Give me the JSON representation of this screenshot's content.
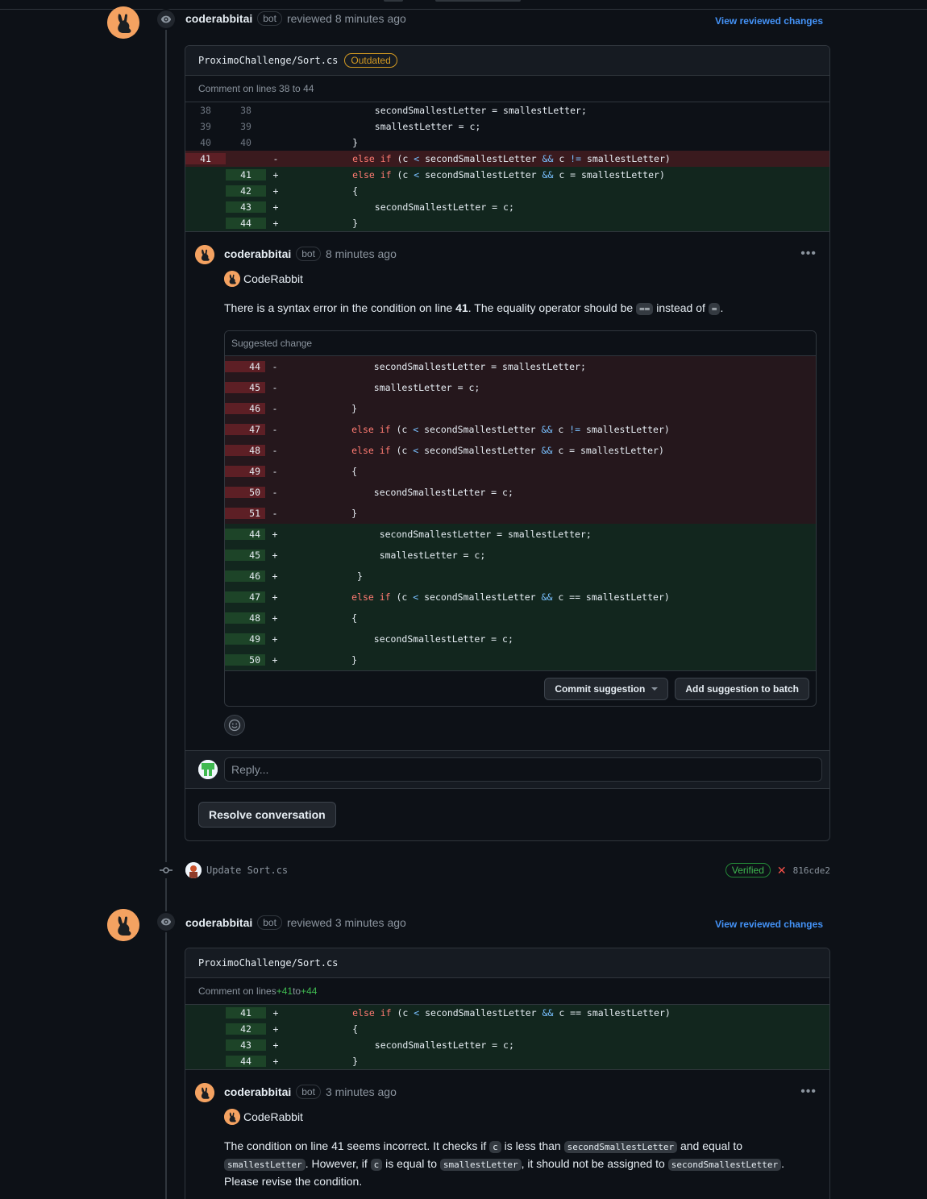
{
  "review1": {
    "author": "coderabbitai",
    "bot_label": "bot",
    "action": "reviewed 8 minutes ago",
    "view_link": "View reviewed changes",
    "file": "ProximoChallenge/Sort.cs",
    "outdated_label": "Outdated",
    "comment_lines": "Comment on lines 38 to 44",
    "diff": [
      {
        "old": "38",
        "new": "38",
        "sign": "",
        "type": "ctx",
        "code": "                secondSmallestLetter = smallestLetter;"
      },
      {
        "old": "39",
        "new": "39",
        "sign": "",
        "type": "ctx",
        "code": "                smallestLetter = c;"
      },
      {
        "old": "40",
        "new": "40",
        "sign": "",
        "type": "ctx",
        "code": "            }"
      },
      {
        "old": "41",
        "new": "",
        "sign": "-",
        "type": "del",
        "code": "            else if (c < secondSmallestLetter && c != smallestLetter)"
      },
      {
        "old": "",
        "new": "41",
        "sign": "+",
        "type": "add",
        "code": "            else if (c < secondSmallestLetter && c = smallestLetter)"
      },
      {
        "old": "",
        "new": "42",
        "sign": "+",
        "type": "add",
        "code": "            {"
      },
      {
        "old": "",
        "new": "43",
        "sign": "+",
        "type": "add",
        "code": "                secondSmallestLetter = c;"
      },
      {
        "old": "",
        "new": "44",
        "sign": "+",
        "type": "add",
        "code": "            }"
      }
    ],
    "comment": {
      "author": "coderabbitai",
      "bot_label": "bot",
      "time": "8 minutes ago",
      "brand": "CodeRabbit",
      "text_a": "There is a syntax error in the condition on line ",
      "text_line": "41",
      "text_b": ". The equality operator should be ",
      "chip1": "==",
      "text_c": " instead of ",
      "chip2": "=",
      "text_d": ".",
      "suggest_title": "Suggested change",
      "suggest_rows": [
        {
          "ln": "44",
          "sign": "-",
          "type": "del",
          "code": "                secondSmallestLetter = smallestLetter;"
        },
        {
          "ln": "45",
          "sign": "-",
          "type": "del",
          "code": "                smallestLetter = c;"
        },
        {
          "ln": "46",
          "sign": "-",
          "type": "del",
          "code": "            }"
        },
        {
          "ln": "47",
          "sign": "-",
          "type": "del",
          "code": "            else if (c < secondSmallestLetter && c != smallestLetter)"
        },
        {
          "ln": "48",
          "sign": "-",
          "type": "del",
          "code": "            else if (c < secondSmallestLetter && c = smallestLetter)"
        },
        {
          "ln": "49",
          "sign": "-",
          "type": "del",
          "code": "            {"
        },
        {
          "ln": "50",
          "sign": "-",
          "type": "del",
          "code": "                secondSmallestLetter = c;"
        },
        {
          "ln": "51",
          "sign": "-",
          "type": "del",
          "code": "            }"
        },
        {
          "ln": "44",
          "sign": "+",
          "type": "add",
          "code": "                 secondSmallestLetter = smallestLetter;"
        },
        {
          "ln": "45",
          "sign": "+",
          "type": "add",
          "code": "                 smallestLetter = c;"
        },
        {
          "ln": "46",
          "sign": "+",
          "type": "add",
          "code": "             }"
        },
        {
          "ln": "47",
          "sign": "+",
          "type": "add",
          "code": "            else if (c < secondSmallestLetter && c == smallestLetter)"
        },
        {
          "ln": "48",
          "sign": "+",
          "type": "add",
          "code": "            {"
        },
        {
          "ln": "49",
          "sign": "+",
          "type": "add",
          "code": "                secondSmallestLetter = c;"
        },
        {
          "ln": "50",
          "sign": "+",
          "type": "add",
          "code": "            }"
        }
      ],
      "commit_btn": "Commit suggestion",
      "batch_btn": "Add suggestion to batch"
    },
    "reply_placeholder": "Reply...",
    "resolve_btn": "Resolve conversation"
  },
  "commit": {
    "message": "Update Sort.cs",
    "verified": "Verified",
    "sha": "816cde2"
  },
  "review2": {
    "author": "coderabbitai",
    "bot_label": "bot",
    "action": "reviewed 3 minutes ago",
    "view_link": "View reviewed changes",
    "file": "ProximoChallenge/Sort.cs",
    "comment_lines_a": "Comment on lines ",
    "comment_lines_b": "+41",
    "comment_lines_c": " to ",
    "comment_lines_d": "+44",
    "diff": [
      {
        "old": "",
        "new": "41",
        "sign": "+",
        "type": "add",
        "code": "            else if (c < secondSmallestLetter && c == smallestLetter)"
      },
      {
        "old": "",
        "new": "42",
        "sign": "+",
        "type": "add",
        "code": "            {"
      },
      {
        "old": "",
        "new": "43",
        "sign": "+",
        "type": "add",
        "code": "                secondSmallestLetter = c;"
      },
      {
        "old": "",
        "new": "44",
        "sign": "+",
        "type": "add",
        "code": "            }"
      }
    ],
    "comment": {
      "author": "coderabbitai",
      "bot_label": "bot",
      "time": "3 minutes ago",
      "brand": "CodeRabbit",
      "t1": "The condition on line 41 seems incorrect. It checks if ",
      "c1": "c",
      "t2": " is less than ",
      "c2": "secondSmallestLetter",
      "t3": " and equal to ",
      "c3": "smallestLetter",
      "t4": ". However, if ",
      "c4": "c",
      "t5": " is equal to ",
      "c5": "smallestLetter",
      "t6": ", it should not be assigned to ",
      "c6": "secondSmallestLetter",
      "t7": ". Please revise the condition."
    }
  },
  "colors": {
    "avatar_bg": "#f4a261",
    "link": "#4493f8",
    "outdated": "#d29922",
    "verified": "#3fb950",
    "fail": "#f85149"
  },
  "icons": [
    "eye-icon",
    "rabbit-avatar-icon",
    "kebab-menu-icon",
    "smiley-icon",
    "commit-icon",
    "x-fail-icon",
    "chevron-down-icon"
  ]
}
